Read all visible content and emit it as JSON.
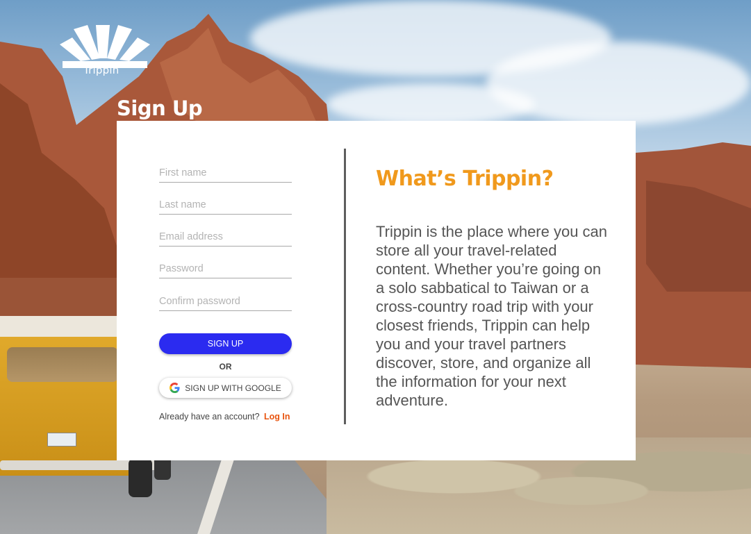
{
  "app": {
    "name": "Trippin"
  },
  "page": {
    "title": "Sign Up"
  },
  "form": {
    "first_name_placeholder": "First name",
    "last_name_placeholder": "Last name",
    "email_placeholder": "Email address",
    "password_placeholder": "Password",
    "confirm_password_placeholder": "Confirm password",
    "signup_label": "SIGN UP",
    "or_label": "OR",
    "google_label": "SIGN UP WITH GOOGLE",
    "login_prompt": "Already have an account?",
    "login_link": "Log In"
  },
  "info": {
    "title": "What’s Trippin?",
    "body": "Trippin is the place where you can store all your travel-related content. Whether you’re going on a solo sabbatical to Taiwan or a cross-country road trip with your closest friends, Trippin can help you and your travel partners discover, store, and organize all the information for your next adventure."
  },
  "colors": {
    "primary_button": "#2b2bf0",
    "accent_orange": "#f0991c",
    "link_orange": "#e8540f"
  },
  "icons": [
    "sun-logo-icon",
    "google-icon"
  ]
}
